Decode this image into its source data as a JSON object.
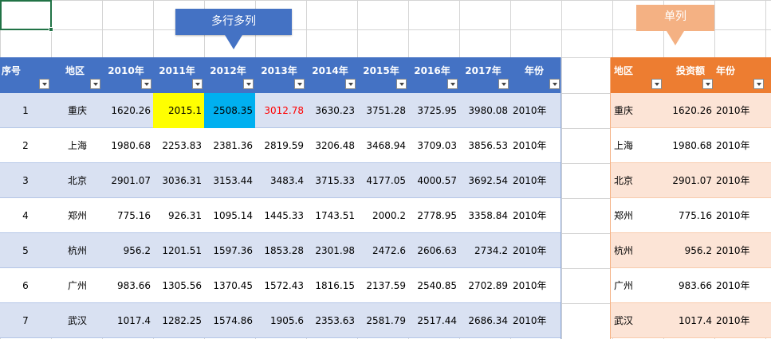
{
  "callouts": {
    "multi": "多行多列",
    "single": "单列"
  },
  "left_table": {
    "headers": [
      "序号",
      "地区",
      "2010年",
      "2011年",
      "2012年",
      "2013年",
      "2014年",
      "2015年",
      "2016年",
      "2017年",
      "年份"
    ],
    "rows": [
      [
        "1",
        "重庆",
        "1620.26",
        "2015.1",
        "2508.35",
        "3012.78",
        "3630.23",
        "3751.28",
        "3725.95",
        "3980.08",
        "2010年"
      ],
      [
        "2",
        "上海",
        "1980.68",
        "2253.83",
        "2381.36",
        "2819.59",
        "3206.48",
        "3468.94",
        "3709.03",
        "3856.53",
        "2010年"
      ],
      [
        "3",
        "北京",
        "2901.07",
        "3036.31",
        "3153.44",
        "3483.4",
        "3715.33",
        "4177.05",
        "4000.57",
        "3692.54",
        "2010年"
      ],
      [
        "4",
        "郑州",
        "775.16",
        "926.31",
        "1095.14",
        "1445.33",
        "1743.51",
        "2000.2",
        "2778.95",
        "3358.84",
        "2010年"
      ],
      [
        "5",
        "杭州",
        "956.2",
        "1201.51",
        "1597.36",
        "1853.28",
        "2301.98",
        "2472.6",
        "2606.63",
        "2734.2",
        "2010年"
      ],
      [
        "6",
        "广州",
        "983.66",
        "1305.56",
        "1370.45",
        "1572.43",
        "1816.15",
        "2137.59",
        "2540.85",
        "2702.89",
        "2010年"
      ],
      [
        "7",
        "武汉",
        "1017.4",
        "1282.25",
        "1574.86",
        "1905.6",
        "2353.63",
        "2581.79",
        "2517.44",
        "2686.34",
        "2010年"
      ]
    ]
  },
  "right_table": {
    "headers": [
      "地区",
      "投资额",
      "年份"
    ],
    "rows": [
      [
        "重庆",
        "1620.26",
        "2010年"
      ],
      [
        "上海",
        "1980.68",
        "2010年"
      ],
      [
        "北京",
        "2901.07",
        "2010年"
      ],
      [
        "郑州",
        "775.16",
        "2010年"
      ],
      [
        "杭州",
        "956.2",
        "2010年"
      ],
      [
        "广州",
        "983.66",
        "2010年"
      ],
      [
        "武汉",
        "1017.4",
        "2010年"
      ]
    ]
  },
  "colors": {
    "header_blue": "#4472c4",
    "band_blue": "#d9e1f2",
    "header_orange": "#ed7d31",
    "band_orange": "#fce4d6",
    "callout_blue": "#4472c4",
    "callout_orange": "#f4b183",
    "highlight_yellow": "#ffff00",
    "highlight_cyan": "#00b0f0",
    "red_text": "#ff0000",
    "selection_green": "#217346"
  }
}
